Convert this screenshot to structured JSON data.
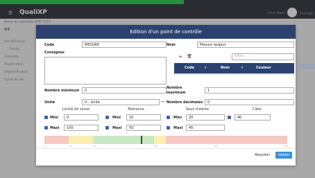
{
  "app": {
    "logo": "QualiXP",
    "user_name": "Pierre Dupré",
    "user_role": "Chef RQE"
  },
  "background": {
    "title": "fiche du contrôle APE 7357",
    "section": "##",
    "sidebar_items": [
      "Identification",
      "Points",
      "Contexte",
      "Planification",
      "Déplanification",
      "Cycle de vie"
    ]
  },
  "dialog": {
    "title": "Edition d'un point de contrôle",
    "code_label": "Code",
    "code_value": "MESURE",
    "nom_label": "Nom",
    "nom_value": "Mesure largeur",
    "consignes_label": "Consignes",
    "consignes_value": "",
    "toolbar": {
      "add_glyph": "+",
      "filter_placeholder": "Filtrer..."
    },
    "table_headers": [
      "Code",
      "Nom",
      "Couleur"
    ],
    "nombre_minimum_label": "Nombre minimum",
    "nombre_minimum_value": "0",
    "nombre_maximum_label": "Nombre maximum",
    "nombre_maximum_value": "1",
    "unite_label": "Unité",
    "unite_value": "U - Unité",
    "unite_more": "...",
    "nombre_decimales_label": "Nombre décimales",
    "nombre_decimales_value": "0",
    "groups": {
      "limite_saisie": "Limite de saisie",
      "tolerance": "Tolérance",
      "seuil_alerte": "Seuil d'alerte",
      "cible": "Cible"
    },
    "mini_label": "Mini",
    "maxi_label": "Maxi",
    "limite_mini": "0",
    "limite_maxi": "100",
    "tolerance_mini": "10",
    "tolerance_maxi": "50",
    "alerte_mini": "20",
    "alerte_maxi": "45",
    "cible_value": "40",
    "gauge_ticks": [
      "0",
      "10",
      "20",
      "45",
      "50",
      "100"
    ],
    "cancel_label": "Abandon",
    "ok_label": "Valider",
    "colors": {
      "header": "#2b4270",
      "red_zone": "#f6c9c4",
      "yellow_zone": "#fbeeb0",
      "green_zone": "#c8e7c5",
      "accent": "#3a8fd9"
    }
  }
}
